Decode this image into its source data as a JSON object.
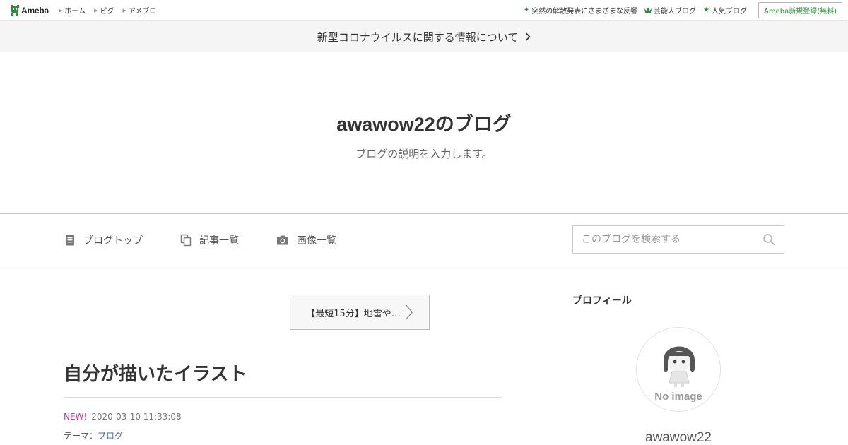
{
  "topbar": {
    "logo_text": "Ameba",
    "nav": [
      "ホーム",
      "ピグ",
      "アメブロ"
    ],
    "right": [
      {
        "label": "突然の解散発表にさまざまな反響",
        "icon": "sparkle-icon"
      },
      {
        "label": "芸能人ブログ",
        "icon": "crown-icon"
      },
      {
        "label": "人気ブログ",
        "icon": "star-icon"
      }
    ],
    "signup": "Ameba新規登録(無料)"
  },
  "notice": {
    "text": "新型コロナウイルスに関する情報について"
  },
  "hero": {
    "title": "awawow22のブログ",
    "description": "ブログの説明を入力します。"
  },
  "nav": {
    "items": [
      {
        "label": "ブログトップ",
        "icon": "document-icon"
      },
      {
        "label": "記事一覧",
        "icon": "copy-icon"
      },
      {
        "label": "画像一覧",
        "icon": "camera-icon"
      }
    ],
    "search_placeholder": "このブログを検索する"
  },
  "entry": {
    "prev_link": "【最短15分】地雷や…",
    "title": "自分が描いたイラスト",
    "new_badge": "NEW!",
    "datetime": "2020-03-10 11:33:08",
    "theme_label": "テーマ：",
    "theme_value": "ブログ"
  },
  "sidebar": {
    "heading": "プロフィール",
    "no_image": "No image",
    "name": "awawow22"
  },
  "colors": {
    "accent_green": "#2d8c3c",
    "new_pink": "#e0309a",
    "link_blue": "#3a6fb5"
  }
}
